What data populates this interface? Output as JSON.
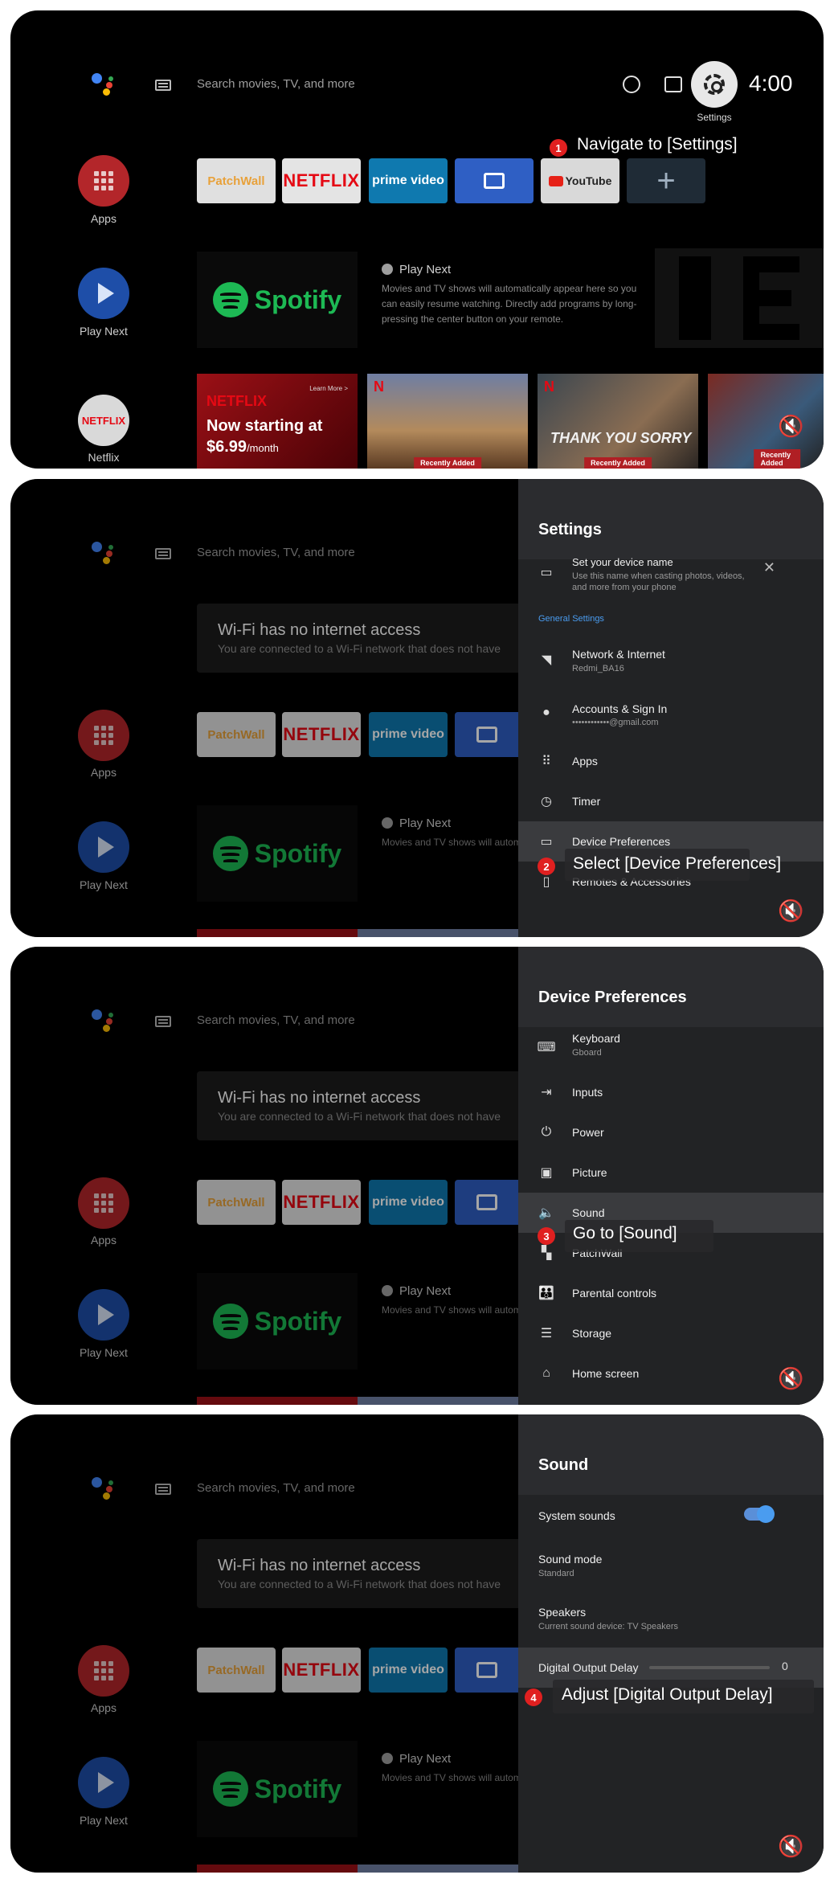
{
  "common": {
    "search_placeholder": "Search movies, TV, and more",
    "apps_label": "Apps",
    "play_next_label": "Play Next",
    "netflix_label": "Netflix",
    "netflix_icon_text": "NETFLIX",
    "patchwall": "PatchWall",
    "netflix_tile": "NETFLIX",
    "prime_tile": "prime video",
    "youtube_tile": "YouTube",
    "add_tile": "+",
    "spotify": "Spotify",
    "play_next_title": "Play Next",
    "play_next_desc": "Movies and TV shows will automatically appear here so you can easily resume watching. Directly add programs by long-pressing the center button on your remote."
  },
  "screen1": {
    "time": "4:00",
    "settings_label": "Settings",
    "cards": {
      "c1_brand": "NETFLIX",
      "c1_line1": "Now starting at",
      "c1_price": "$6.99",
      "c1_unit": "/month",
      "c1_learn": "Learn More >",
      "recently_added": "Recently Added",
      "c3_title": "THANK YOU SORRY"
    },
    "step_num": "1",
    "step_text": "Navigate to [Settings]"
  },
  "wifi": {
    "title": "Wi-Fi has no internet access",
    "subtitle": "You are connected to a Wi-Fi network that does not have"
  },
  "screen2": {
    "panel_title": "Settings",
    "device_name_title": "Set your device name",
    "device_name_desc": "Use this name when casting photos, videos, and more from your phone",
    "section": "General Settings",
    "items": [
      {
        "label": "Network & Internet",
        "sub": "Redmi_BA16"
      },
      {
        "label": "Accounts & Sign In",
        "sub": "••••••••••••@gmail.com"
      },
      {
        "label": "Apps",
        "sub": ""
      },
      {
        "label": "Timer",
        "sub": ""
      },
      {
        "label": "Device Preferences",
        "sub": ""
      },
      {
        "label": "Remotes & Accessories",
        "sub": ""
      }
    ],
    "step_num": "2",
    "step_text": "Select [Device Preferences]"
  },
  "screen3": {
    "panel_title": "Device Preferences",
    "items": [
      {
        "label": "Keyboard",
        "sub": "Gboard"
      },
      {
        "label": "Inputs",
        "sub": ""
      },
      {
        "label": "Power",
        "sub": ""
      },
      {
        "label": "Picture",
        "sub": ""
      },
      {
        "label": "Sound",
        "sub": ""
      },
      {
        "label": "PatchWall",
        "sub": ""
      },
      {
        "label": "Parental controls",
        "sub": ""
      },
      {
        "label": "Storage",
        "sub": ""
      },
      {
        "label": "Home screen",
        "sub": ""
      }
    ],
    "step_num": "3",
    "step_text": "Go to [Sound]"
  },
  "screen4": {
    "panel_title": "Sound",
    "system_sounds": "System sounds",
    "system_sounds_on": true,
    "sound_mode": "Sound mode",
    "sound_mode_value": "Standard",
    "speakers": "Speakers",
    "speakers_value": "Current sound device: TV Speakers",
    "digital_delay": "Digital Output Delay",
    "digital_delay_value": "0",
    "step_num": "4",
    "step_text": "Adjust [Digital Output Delay]"
  },
  "colors": {
    "step_badge": "#e02020",
    "toggle_on": "#4a9cf0",
    "section_accent": "#4a9cf0"
  }
}
